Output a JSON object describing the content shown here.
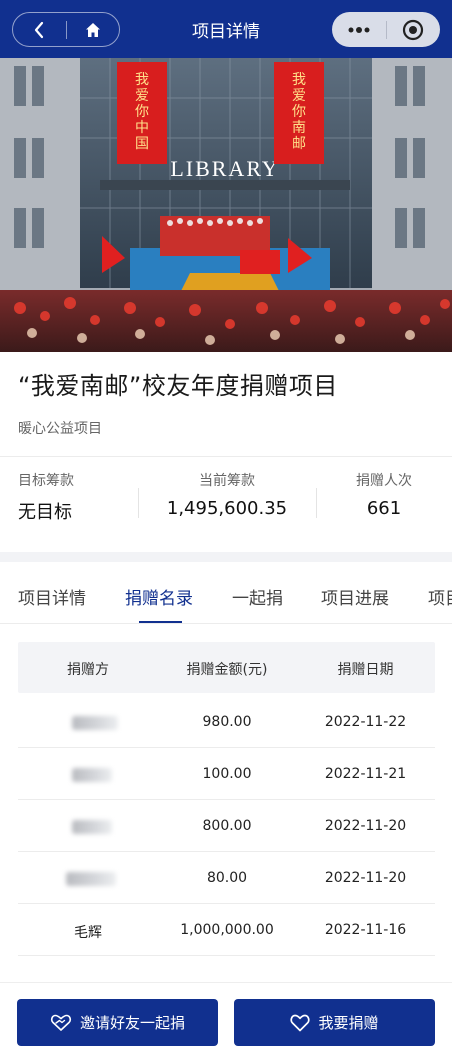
{
  "header": {
    "title": "项目详情",
    "back_icon": "chevron-left-icon",
    "home_icon": "home-icon",
    "more_icon": "more-dots-icon",
    "close_icon": "target-circle-icon"
  },
  "banner": {
    "sign_text": "LIBRARY",
    "left_banner_text": "我爱你中国",
    "right_banner_text": "我爱你南邮"
  },
  "project": {
    "title": "“我爱南邮”校友年度捐赠项目",
    "subtitle": "暖心公益项目"
  },
  "stats": {
    "target_label": "目标筹款",
    "target_value": "无目标",
    "current_label": "当前筹款",
    "current_value": "1,495,600.35",
    "donors_label": "捐赠人次",
    "donors_value": "661"
  },
  "tabs": [
    {
      "label": "项目详情",
      "active": false
    },
    {
      "label": "捐赠名录",
      "active": true
    },
    {
      "label": "一起捐",
      "active": false
    },
    {
      "label": "项目进展",
      "active": false
    },
    {
      "label": "项目",
      "active": false
    }
  ],
  "table": {
    "headers": [
      "捐赠方",
      "捐赠金额(元)",
      "捐赠日期"
    ],
    "rows": [
      {
        "donor": "",
        "amount": "980.00",
        "date": "2022-11-22"
      },
      {
        "donor": "",
        "amount": "100.00",
        "date": "2022-11-21"
      },
      {
        "donor": "",
        "amount": "800.00",
        "date": "2022-11-20"
      },
      {
        "donor": "",
        "amount": "80.00",
        "date": "2022-11-20"
      },
      {
        "donor": "毛辉",
        "amount": "1,000,000.00",
        "date": "2022-11-16"
      }
    ]
  },
  "actions": {
    "invite_label": "邀请好友一起捐",
    "invite_icon": "handshake-heart-icon",
    "donate_label": "我要捐赠",
    "donate_icon": "heart-icon"
  },
  "colors": {
    "primary": "#11308f",
    "banner_red": "#d81e1e"
  }
}
